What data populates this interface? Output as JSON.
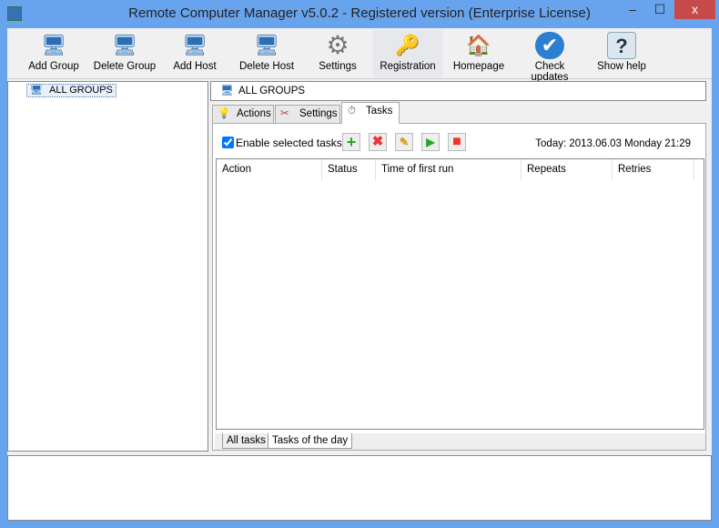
{
  "window": {
    "title": "Remote Computer Manager v5.0.2 - Registered version (Enterprise License)",
    "minimize": "–",
    "maximize": "☐",
    "close": "x"
  },
  "toolbar": [
    {
      "label": "Add Group",
      "icon": "🖥"
    },
    {
      "label": "Delete Group",
      "icon": "🖥"
    },
    {
      "label": "Add Host",
      "icon": "🖥"
    },
    {
      "label": "Delete Host",
      "icon": "🖥"
    },
    {
      "label": "Settings",
      "icon": "⚙"
    },
    {
      "label": "Registration",
      "icon": "🔑"
    },
    {
      "label": "Homepage",
      "icon": "🏠"
    },
    {
      "label": "Check updates",
      "icon": "✔"
    },
    {
      "label": "Show help",
      "icon": "?"
    }
  ],
  "tree": {
    "root": "ALL GROUPS"
  },
  "breadcrumb": "ALL GROUPS",
  "tabs": [
    "Actions",
    "Settings",
    "Tasks"
  ],
  "tasks": {
    "enable_label": "Enable selected tasks",
    "today": "Today: 2013.06.03 Monday 21:29",
    "columns": [
      "Action",
      "Status",
      "Time of first run",
      "Repeats",
      "Retries"
    ],
    "bottom_tabs": [
      "All tasks",
      "Tasks of the day"
    ]
  }
}
